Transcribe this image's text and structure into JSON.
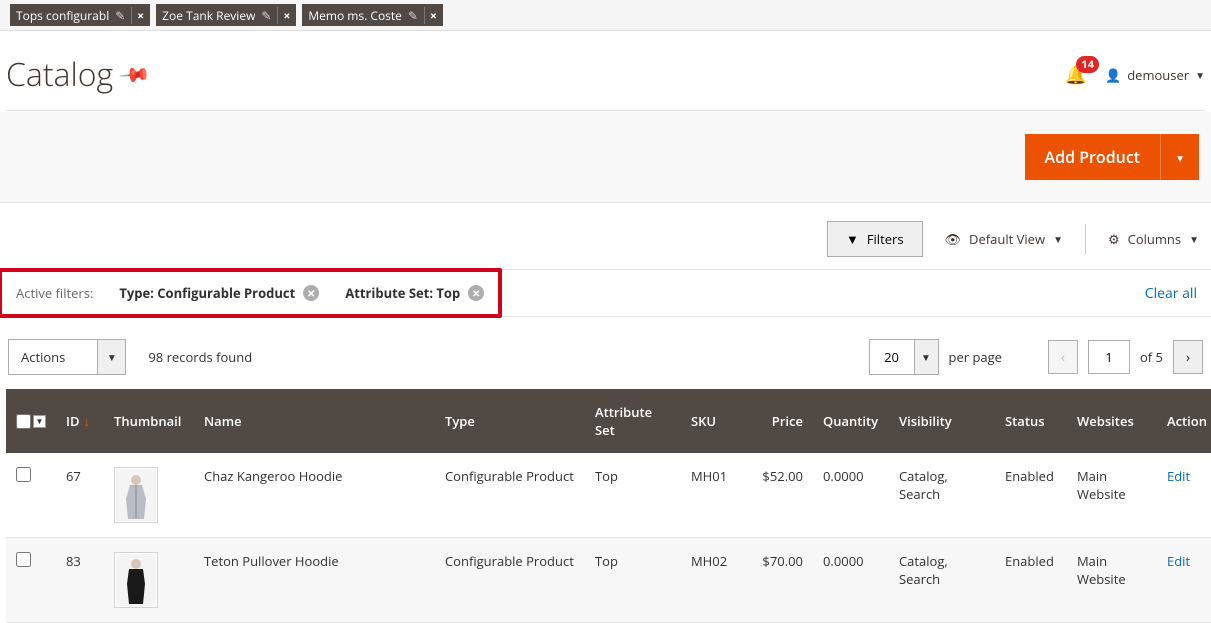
{
  "tabs": [
    {
      "label": "Tops configurabl"
    },
    {
      "label": "Zoe Tank Review"
    },
    {
      "label": "Memo ms. Coste"
    }
  ],
  "page": {
    "title": "Catalog"
  },
  "header": {
    "notif_count": "14",
    "username": "demouser"
  },
  "actions": {
    "add_product": "Add Product"
  },
  "toolbar": {
    "filters": "Filters",
    "default_view": "Default View",
    "columns": "Columns"
  },
  "active_filters": {
    "label": "Active filters:",
    "chips": [
      {
        "text": "Type: Configurable Product"
      },
      {
        "text": "Attribute Set: Top"
      }
    ],
    "clear_all": "Clear all"
  },
  "listing": {
    "actions_label": "Actions",
    "records_found": "98 records found",
    "per_page_value": "20",
    "per_page_label": "per page",
    "current_page": "1",
    "of_label": "of 5"
  },
  "columns": {
    "id": "ID",
    "thumbnail": "Thumbnail",
    "name": "Name",
    "type": "Type",
    "attribute_set": "Attribute Set",
    "sku": "SKU",
    "price": "Price",
    "quantity": "Quantity",
    "visibility": "Visibility",
    "status": "Status",
    "websites": "Websites",
    "action": "Action"
  },
  "rows": [
    {
      "id": "67",
      "name": "Chaz Kangeroo Hoodie",
      "type": "Configurable Product",
      "attr": "Top",
      "sku": "MH01",
      "price": "$52.00",
      "qty": "0.0000",
      "vis": "Catalog, Search",
      "status": "Enabled",
      "web": "Main Website",
      "action": "Edit"
    },
    {
      "id": "83",
      "name": "Teton Pullover Hoodie",
      "type": "Configurable Product",
      "attr": "Top",
      "sku": "MH02",
      "price": "$70.00",
      "qty": "0.0000",
      "vis": "Catalog, Search",
      "status": "Enabled",
      "web": "Main Website",
      "action": "Edit"
    }
  ]
}
